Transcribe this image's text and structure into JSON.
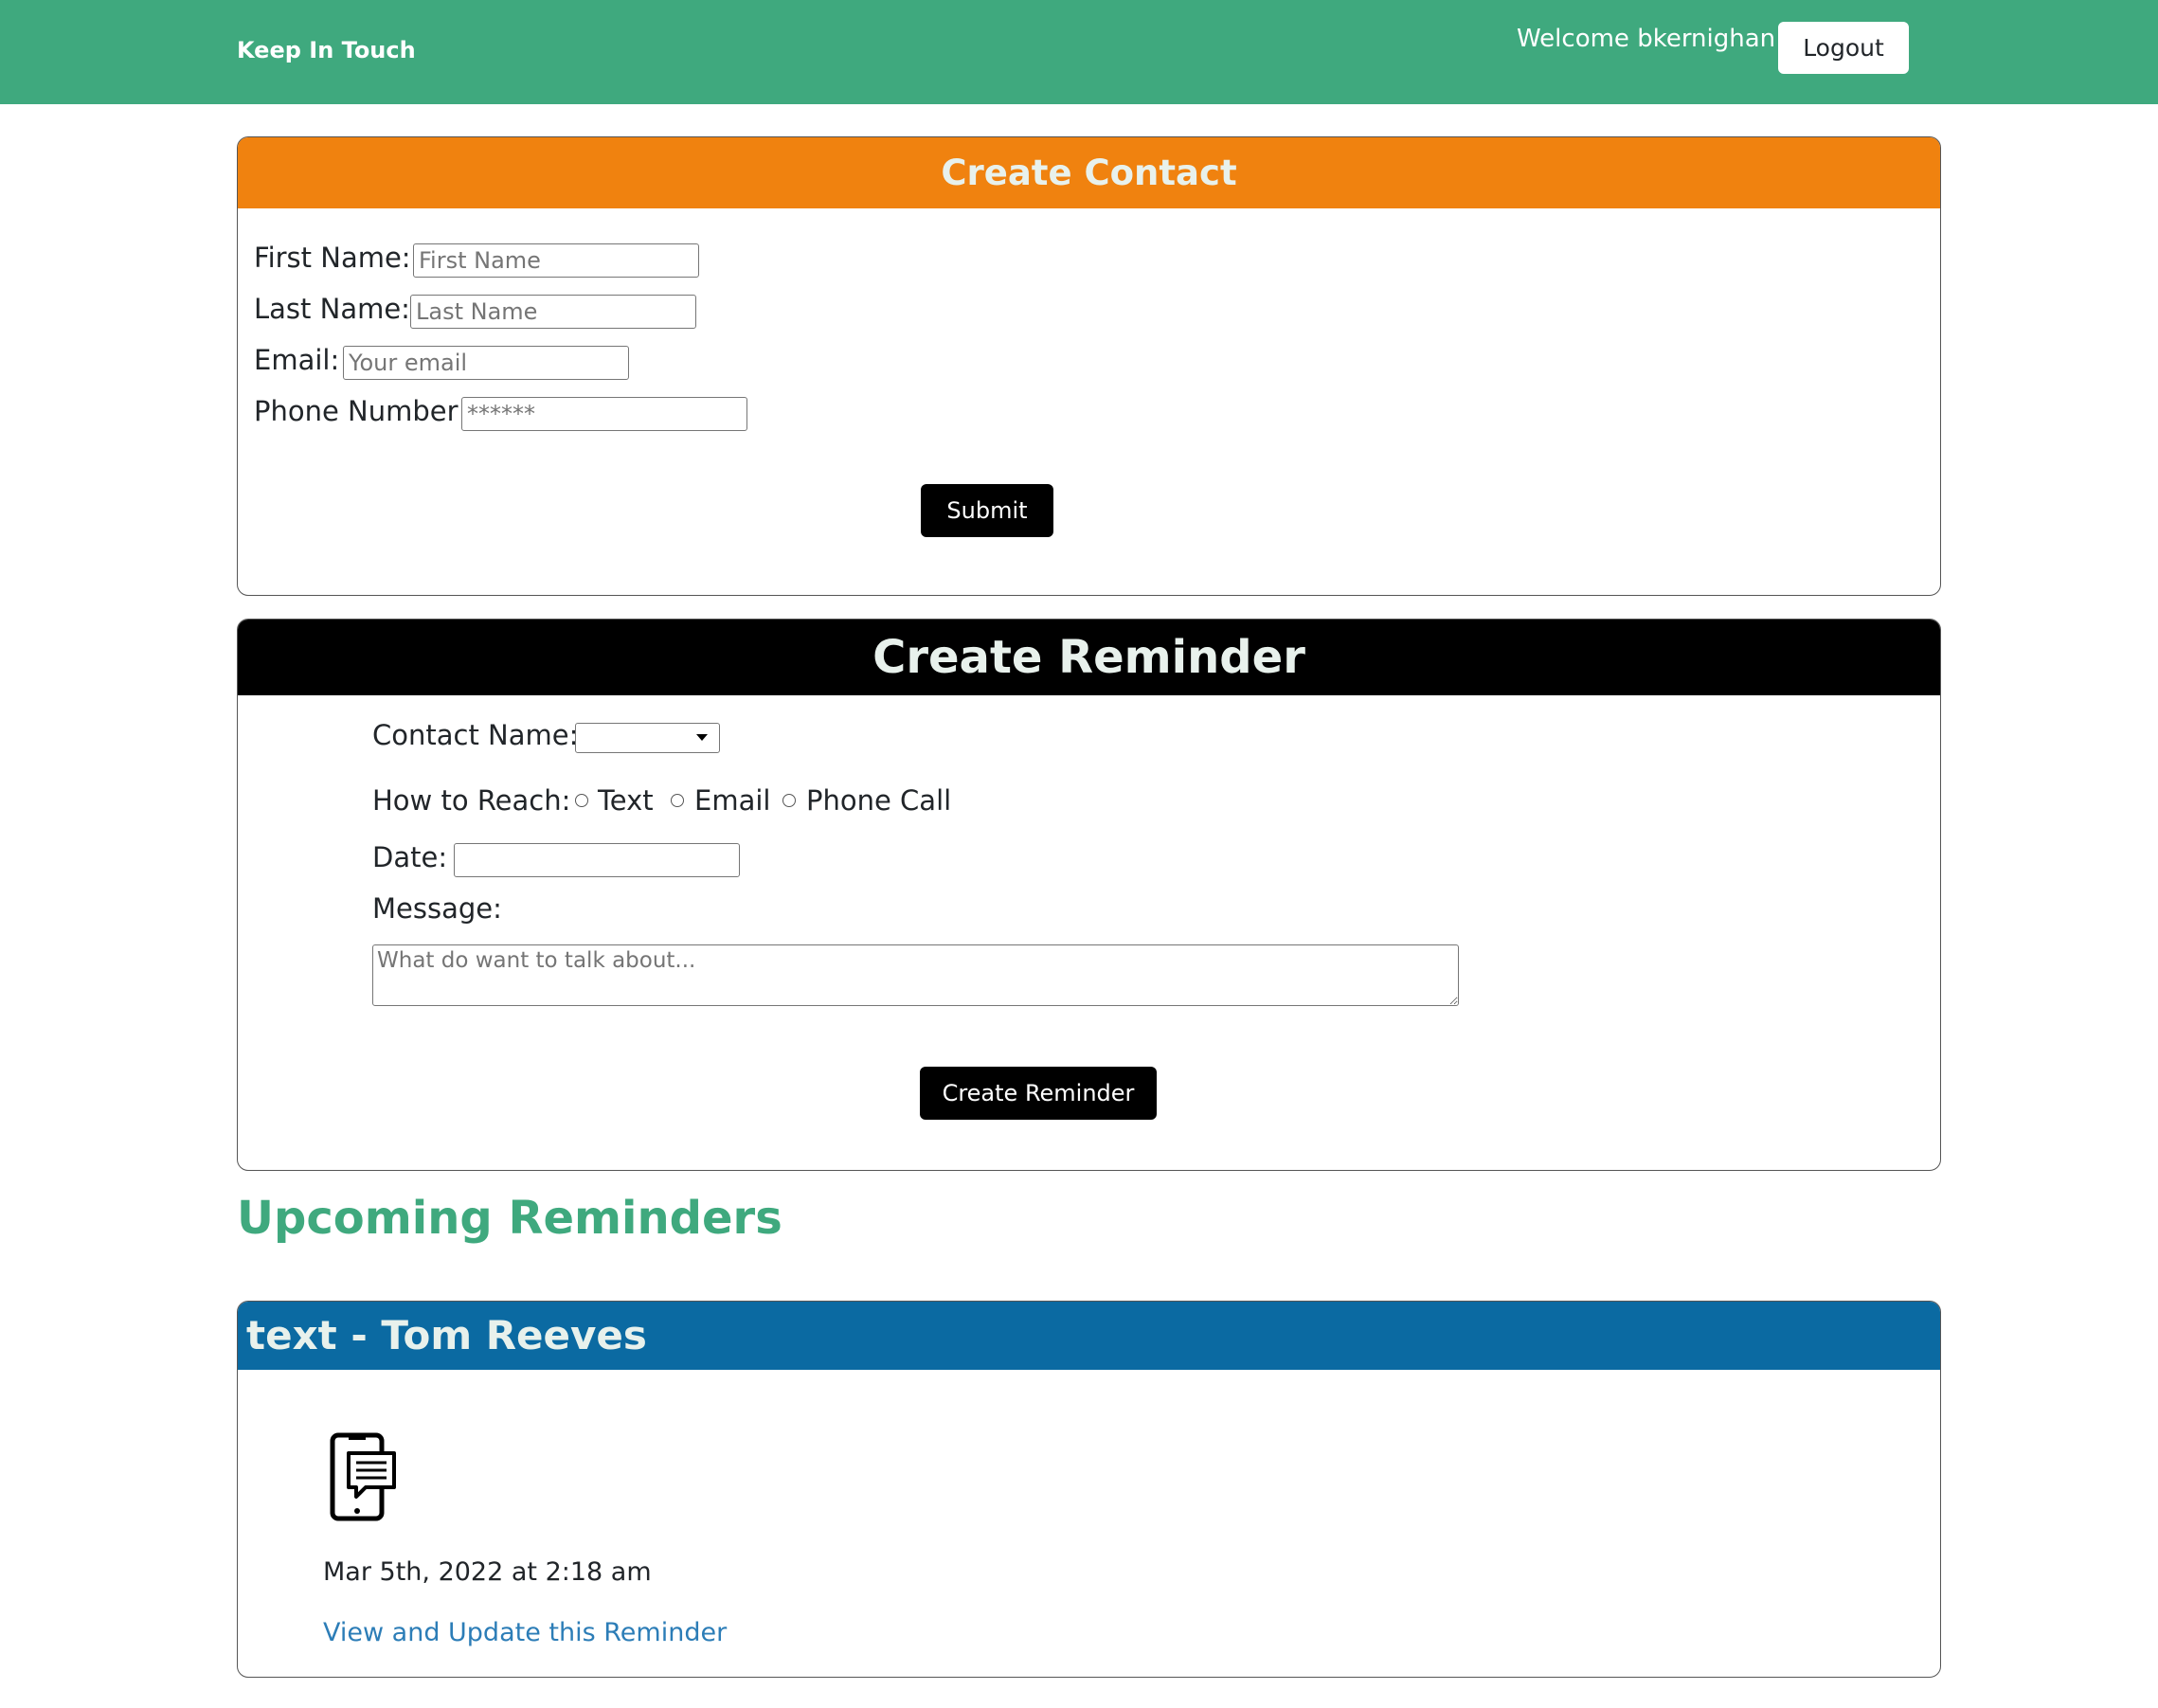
{
  "navbar": {
    "brand": "Keep In Touch",
    "welcome": "Welcome bkernighan",
    "logout_label": "Logout",
    "bg_color": "#3fa97e"
  },
  "create_contact": {
    "title": "Create Contact",
    "header_color": "#f0820f",
    "first_name": {
      "label": "First Name:",
      "placeholder": "First Name",
      "value": ""
    },
    "last_name": {
      "label": "Last Name:",
      "placeholder": "Last Name",
      "value": ""
    },
    "email": {
      "label": "Email:",
      "placeholder": "Your email",
      "value": ""
    },
    "phone": {
      "label": "Phone Number",
      "placeholder": "******",
      "value": ""
    },
    "submit_label": "Submit"
  },
  "create_reminder": {
    "title": "Create Reminder",
    "header_color": "#000000",
    "contact_name_label": "Contact Name:",
    "contact_name_selected": "",
    "how_to_reach_label": "How to Reach:",
    "reach_options": [
      "Text",
      "Email",
      "Phone Call"
    ],
    "date_label": "Date:",
    "date_value": "",
    "message_label": "Message:",
    "message_placeholder": "What do want to talk about...",
    "submit_label": "Create Reminder"
  },
  "upcoming": {
    "section_title": "Upcoming Reminders",
    "reminders": [
      {
        "header": "text - Tom Reeves",
        "header_color": "#0b6aa2",
        "icon": "phone-message-icon",
        "date": "Mar 5th, 2022 at 2:18 am",
        "link_label": "View and Update this Reminder"
      }
    ]
  }
}
